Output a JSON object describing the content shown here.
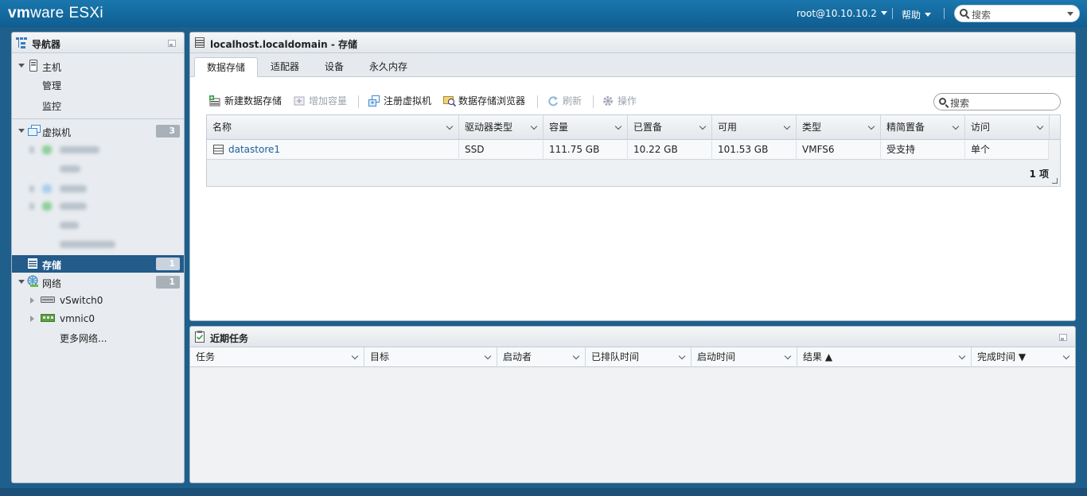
{
  "topbar": {
    "brand_vm": "vm",
    "brand_ware": "ware",
    "product": "ESXi",
    "user": "root@10.10.10.2",
    "help": "帮助",
    "search_placeholder": "搜索"
  },
  "navigator": {
    "title": "导航器",
    "host": "主机",
    "host_children": [
      "管理",
      "监控"
    ],
    "vms": "虚拟机",
    "vms_count": "3",
    "storage": "存储",
    "storage_count": "1",
    "network": "网络",
    "network_count": "1",
    "network_children": [
      "vSwitch0",
      "vmnic0",
      "更多网络..."
    ]
  },
  "main": {
    "title": "localhost.localdomain - 存储",
    "tabs": [
      "数据存储",
      "适配器",
      "设备",
      "永久内存"
    ],
    "active_tab": "数据存储",
    "toolbar": {
      "new_datastore": "新建数据存储",
      "increase_capacity": "增加容量",
      "register_vm": "注册虚拟机",
      "datastore_browser": "数据存储浏览器",
      "refresh": "刷新",
      "actions": "操作"
    },
    "search_placeholder": "搜索",
    "table": {
      "columns": [
        "名称",
        "驱动器类型",
        "容量",
        "已置备",
        "可用",
        "类型",
        "精简置备",
        "访问"
      ],
      "rows": [
        [
          "datastore1",
          "SSD",
          "111.75 GB",
          "10.22 GB",
          "101.53 GB",
          "VMFS6",
          "受支持",
          "单个"
        ]
      ],
      "count": "1 项"
    }
  },
  "tasks": {
    "title": "近期任务",
    "columns": [
      "任务",
      "目标",
      "启动者",
      "已排队时间",
      "启动时间",
      "结果 ▲",
      "完成时间 ▼"
    ]
  },
  "colors": {
    "topbar": "#0f5e92",
    "selected_nav": "#235b8a",
    "link": "#1d5f9c"
  }
}
